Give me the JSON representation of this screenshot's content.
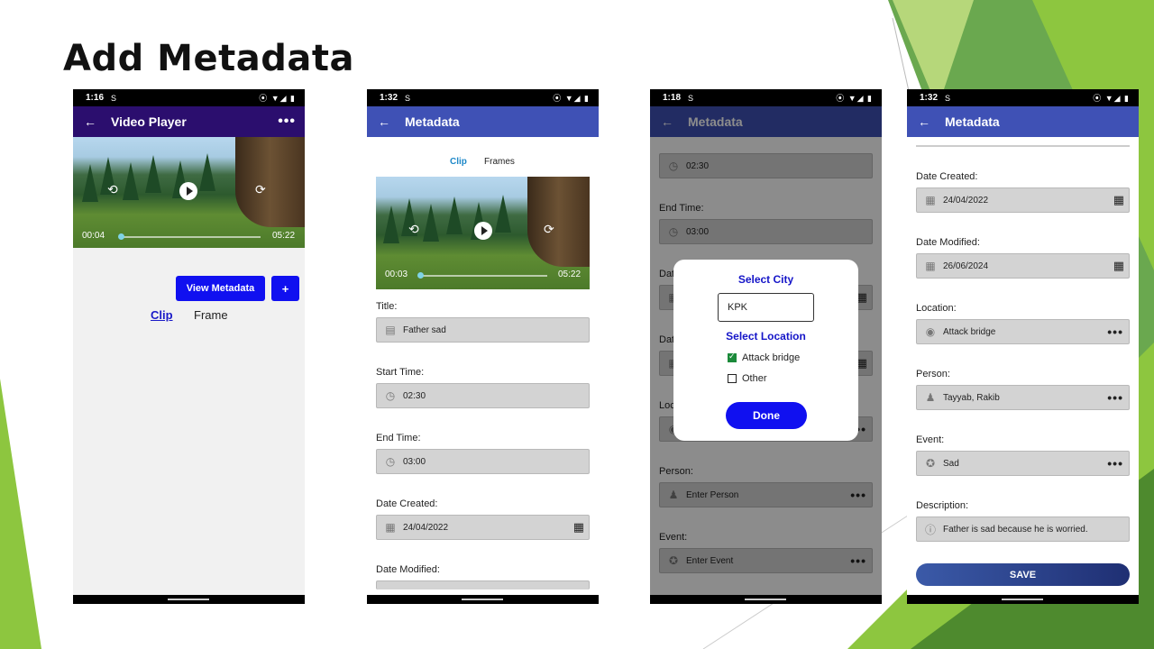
{
  "slide": {
    "title": "Add Metadata"
  },
  "colors": {
    "app_purple": "#2b0e6e",
    "app_blue": "#3f51b5",
    "button_blue": "#1010f0",
    "accent_green": "#8dc63f"
  },
  "phone1": {
    "status_time": "1:16",
    "appbar_title": "Video Player",
    "video": {
      "current_time": "00:04",
      "duration": "05:22",
      "progress": 0.013
    },
    "view_metadata_label": "View Metadata",
    "add_label": "+",
    "tabs": [
      {
        "label": "Clip",
        "active": true
      },
      {
        "label": "Frame",
        "active": false
      }
    ]
  },
  "phone2": {
    "status_time": "1:32",
    "appbar_title": "Metadata",
    "tabs": [
      {
        "label": "Clip",
        "active": true
      },
      {
        "label": "Frames",
        "active": false
      }
    ],
    "video": {
      "current_time": "00:03",
      "duration": "05:22",
      "progress": 0.01
    },
    "fields": [
      {
        "label": "Title:",
        "value": "Father sad",
        "icon": "document-icon"
      },
      {
        "label": "Start Time:",
        "value": "02:30",
        "icon": "clock-icon"
      },
      {
        "label": "End Time:",
        "value": "03:00",
        "icon": "clock-icon"
      },
      {
        "label": "Date Created:",
        "value": "24/04/2022",
        "icon": "calendar-icon"
      },
      {
        "label": "Date Modified:",
        "value": "",
        "icon": "calendar-icon"
      }
    ]
  },
  "phone3": {
    "status_time": "1:18",
    "appbar_title": "Metadata",
    "bg_fields": [
      {
        "label": "",
        "value": "02:30"
      },
      {
        "label": "End Time:",
        "value": "03:00"
      },
      {
        "label": "Person:",
        "value": "Enter Person"
      },
      {
        "label": "Event:",
        "value": "Enter Event"
      }
    ],
    "partial_labels": [
      "Dat",
      "Dat",
      "Loc"
    ],
    "dialog": {
      "city_title": "Select City",
      "city_value": "KPK",
      "location_title": "Select Location",
      "options": [
        {
          "label": "Attack bridge",
          "checked": true
        },
        {
          "label": "Other",
          "checked": false
        }
      ],
      "done_label": "Done"
    }
  },
  "phone4": {
    "status_time": "1:32",
    "appbar_title": "Metadata",
    "fields": [
      {
        "label": "Date Created:",
        "value": "24/04/2022",
        "icon": "calendar-icon"
      },
      {
        "label": "Date Modified:",
        "value": "26/06/2024",
        "icon": "calendar-icon"
      },
      {
        "label": "Location:",
        "value": "Attack bridge",
        "icon": "location-icon"
      },
      {
        "label": "Person:",
        "value": "Tayyab, Rakib",
        "icon": "person-icon"
      },
      {
        "label": "Event:",
        "value": "Sad",
        "icon": "event-badge-icon"
      },
      {
        "label": "Description:",
        "value": "Father is sad because he is worried.",
        "icon": "info-icon"
      }
    ],
    "save_label": "SAVE"
  }
}
